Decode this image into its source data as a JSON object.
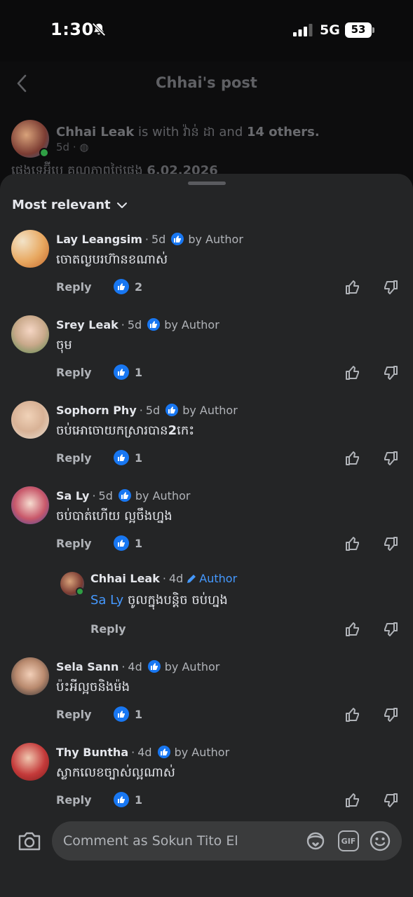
{
  "status_bar": {
    "time": "1:30",
    "network": "5G",
    "battery": "53"
  },
  "header": {
    "title": "Chhai's post"
  },
  "post": {
    "author": "Chhai Leak",
    "with_text": " is with ",
    "tagged": "វ៉ាន់ ដា",
    "and_text": " and ",
    "others": "14 others.",
    "age": "5d",
    "text_prefix": "ផេងទេអ៊ីបេ គុណភាពថ្ងៃផេង",
    "text_date": "6.02.2026"
  },
  "sort": {
    "label": "Most relevant"
  },
  "comments": [
    {
      "name": "Lay Leangsim",
      "age": "5d",
      "badge": "by Author",
      "text": "ចោតល្ងបរហ៊ានខណាស់",
      "reply": "Reply",
      "likes": "2"
    },
    {
      "name": "Srey Leak",
      "age": "5d",
      "badge": "by Author",
      "text": "ចុម",
      "reply": "Reply",
      "likes": "1"
    },
    {
      "name": "Sophorn Phy",
      "age": "5d",
      "badge": "by Author",
      "text_main": "ចប់អោចោយកស្រារបាន",
      "text_bold": "2",
      "text_end": "កេះ",
      "reply": "Reply",
      "likes": "1"
    },
    {
      "name": "Sa Ly",
      "age": "5d",
      "badge": "by Author",
      "text": "ចប់បាត់ហើយ ល្អចឹងហ្នង",
      "reply": "Reply",
      "likes": "1"
    },
    {
      "name": "Sela Sann",
      "age": "4d",
      "badge": "by Author",
      "text": "ប៉ះអីល្អចនិងម៉ង",
      "reply": "Reply",
      "likes": "1"
    },
    {
      "name": "Thy Buntha",
      "age": "4d",
      "badge": "by Author",
      "text": "ស្លាកលេខច្បាស់ល្អណាស់",
      "reply": "Reply",
      "likes": "1"
    }
  ],
  "reply": {
    "name": "Chhai Leak",
    "age": "4d",
    "badge": "Author",
    "mention": "Sa Ly",
    "text": " ចូលក្នុងបន្តិច ចប់ហ្នង",
    "reply": "Reply"
  },
  "composer": {
    "placeholder": "Comment as Sokun Tito El",
    "gif": "GIF"
  },
  "colors": {
    "accent": "#1877f2",
    "mention": "#4599ff",
    "sheet": "#242526",
    "input": "#3a3b3c"
  }
}
